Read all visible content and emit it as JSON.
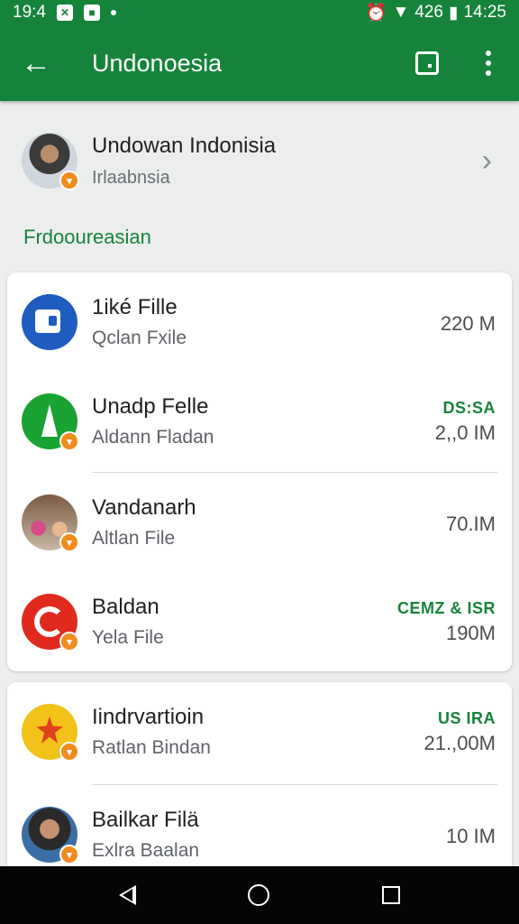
{
  "status_bar": {
    "time_left": "19:4",
    "time": "14:25",
    "battery": "426"
  },
  "app_bar": {
    "title": "Undonoesia"
  },
  "profile": {
    "name": "Undowan Indonisia",
    "subtitle": "Irlaabnsia"
  },
  "section_label": "Frdooureasian",
  "card_one": [
    {
      "title": "1iké Fille",
      "subtitle": "Qclan Fxile",
      "tag": "",
      "size": "220 M",
      "icon": "square-chat-icon",
      "color": "#1e5cbf"
    },
    {
      "title": "Unadp Felle",
      "subtitle": "Aldann Fladan",
      "tag": "DS:SA",
      "size": "2,,0 IM",
      "icon": "triangle-icon",
      "color": "#1aa332"
    },
    {
      "title": "Vandanarh",
      "subtitle": "Altlan File",
      "tag": "",
      "size": "70.IM",
      "icon": "photo-avatar",
      "color": ""
    },
    {
      "title": "Baldan",
      "subtitle": "Yela File",
      "tag": "CEMZ & ISR",
      "size": "190M",
      "icon": "ring-icon",
      "color": "#e02a1d"
    }
  ],
  "card_two": [
    {
      "title": "Iindrvartioin",
      "subtitle": "Ratlan Bindan",
      "tag": "US IRA",
      "size": "21.,00M",
      "icon": "star-badge-icon",
      "color": "#f2c21a"
    },
    {
      "title": "Bailkar Filä",
      "subtitle": "Exlra Baalan",
      "tag": "",
      "size": "10 IM",
      "icon": "photo-avatar",
      "color": ""
    }
  ],
  "badge_glyph": "▾"
}
